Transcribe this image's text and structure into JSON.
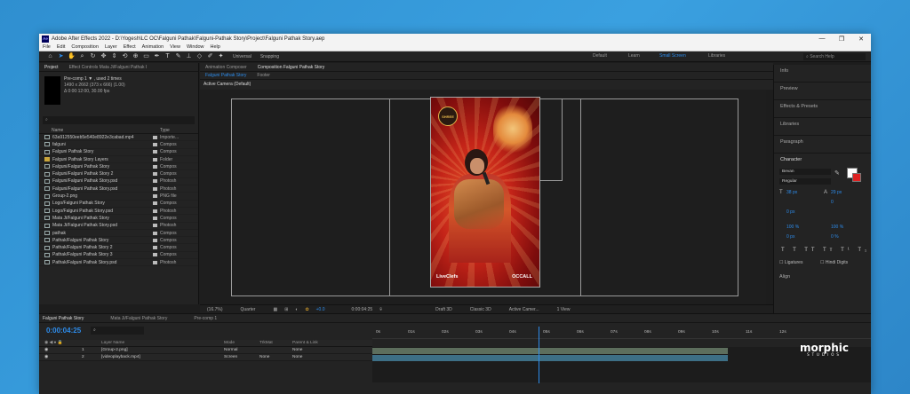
{
  "window": {
    "title": "Adobe After Effects 2022 - D:\\Yogesh\\LC OC\\Falguni Pathak\\Falguni-Pathak Story\\Project\\Falguni Pathak Story.aep",
    "logo_text": "Ae",
    "controls": [
      "—",
      "❐",
      "✕"
    ]
  },
  "menu": [
    "File",
    "Edit",
    "Composition",
    "Layer",
    "Effect",
    "Animation",
    "View",
    "Window",
    "Help"
  ],
  "toolbar": {
    "universal_label": "Universal",
    "snapping_label": "Snapping",
    "workspaces": [
      "Default",
      "Learn",
      "Small Screen",
      "Libraries"
    ],
    "active_workspace": "Small Screen",
    "search_placeholder": "Search Help"
  },
  "project_panel": {
    "tabs": [
      "Project",
      "Effect Controls Mata Ji/Falguni Pathak I"
    ],
    "selected_item": "Pre-comp 1 ▼ , used 2 times",
    "item_info": [
      "1490 x 2662  (373 x 666) (1.00)",
      "Δ 0:00:12:00, 30.00 fps"
    ],
    "col_name": "Name",
    "col_type": "Type",
    "items": [
      {
        "name": "63a912550eeb5e540e8922e3cabad.mp4",
        "type": "Importe..."
      },
      {
        "name": "falguni",
        "type": "Compos"
      },
      {
        "name": "Falguni Pathak Story",
        "type": "Compos"
      },
      {
        "name": "Falguni Pathak Story Layers",
        "type": "Folder"
      },
      {
        "name": "Falguni/Falguni Pathak Story",
        "type": "Compos"
      },
      {
        "name": "Falguni/Falguni Pathak Story 2",
        "type": "Compos"
      },
      {
        "name": "Falguni/Falguni Pathak Story.psd",
        "type": "Photosh"
      },
      {
        "name": "Falguni/Falguni Pathak Story.psd",
        "type": "Photosh"
      },
      {
        "name": "Group-2.png",
        "type": "PNG file"
      },
      {
        "name": "Logo/Falguni Pathak Story",
        "type": "Compos"
      },
      {
        "name": "Logo/Falguni Pathak Story.psd",
        "type": "Photosh"
      },
      {
        "name": "Mata Ji/Falguni Pathak Story",
        "type": "Compos"
      },
      {
        "name": "Mata Ji/Falguni Pathak Story.psd",
        "type": "Photosh"
      },
      {
        "name": "pathak",
        "type": "Compos"
      },
      {
        "name": "Pathak/Falguni Pathak Story",
        "type": "Compos"
      },
      {
        "name": "Pathak/Falguni Pathak Story 2",
        "type": "Compos"
      },
      {
        "name": "Pathak/Falguni Pathak Story 3",
        "type": "Compos"
      },
      {
        "name": "Pathak/Falguni Pathak Story.psd",
        "type": "Photosh"
      }
    ]
  },
  "composition_panel": {
    "tabs": [
      "Animation Composer",
      "Composition Falguni Pathak Story"
    ],
    "sub_tabs": [
      "Falguni Pathak Story",
      "Footer"
    ],
    "camera_label": "Active Camera (Default)",
    "poster_badge": "SHREE",
    "poster_logo_left": "LiveClefs",
    "poster_logo_right": "OCCALL"
  },
  "viewer_footer": {
    "zoom": "(16.7%)",
    "quality": "Quarter",
    "exposure": "+0.0",
    "time": "0:00:04:25",
    "renderer": "Draft 3D",
    "renderer_mode": "Classic 3D",
    "camera": "Active Camer...",
    "view": "1 View"
  },
  "right_panel": {
    "items": [
      "Info",
      "Preview",
      "Effects & Presets",
      "Libraries",
      "Paragraph"
    ],
    "character_title": "Character",
    "font": "Bevan",
    "style": "Regular",
    "size": "38 px",
    "leading": "29 px",
    "tracking": "0",
    "stroke": "0 px",
    "vscale": "100 %",
    "hscale": "100 %",
    "baseline": "0 px",
    "tsume": "0 %",
    "ligatures_label": "Ligatures",
    "hindi_digits_label": "Hindi Digits",
    "align_label": "Align"
  },
  "timeline": {
    "tabs": [
      "Falguni Pathak Story",
      "Mata Ji/Falguni Pathak Story",
      "Pre-comp 1"
    ],
    "timecode": "0:00:04:25",
    "columns": {
      "layer_name": "Layer Name",
      "mode": "Mode",
      "trkmat": "TrkMat",
      "parent": "Parent & Link"
    },
    "layers": [
      {
        "num": "1",
        "name": "[Group-2.png]",
        "mode": "Normal",
        "trkmat": "",
        "parent": "None"
      },
      {
        "num": "2",
        "name": "[videoplayback.mp4]",
        "mode": "Screen",
        "trkmat": "None",
        "parent": "None"
      }
    ],
    "ruler": [
      "0s",
      "01s",
      "02s",
      "03s",
      "04s",
      "05s",
      "06s",
      "07s",
      "08s",
      "09s",
      "10s",
      "11s",
      "12s"
    ]
  },
  "watermark": {
    "brand": "morphic",
    "tagline": "STUDIOS"
  }
}
